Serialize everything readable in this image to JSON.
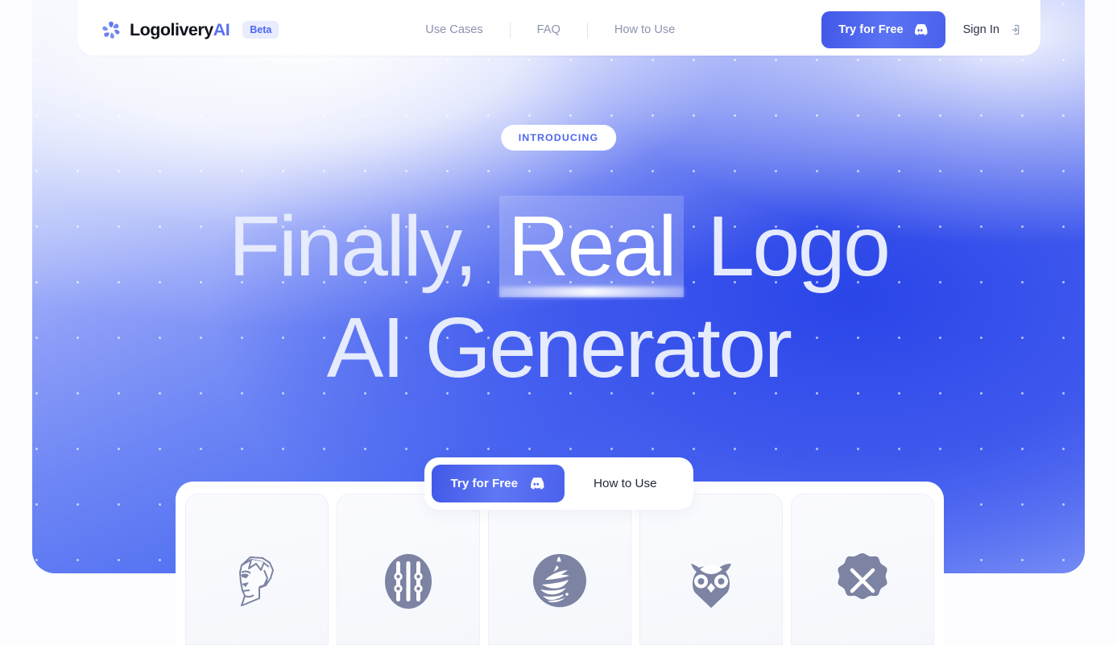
{
  "brand": {
    "name_main": "Logolivery",
    "name_accent": "AI",
    "badge": "Beta",
    "mark_icon": "swirl-petals-logo-icon",
    "accent_color": "#5a72f0"
  },
  "nav": {
    "links": [
      {
        "label": "Use Cases"
      },
      {
        "label": "FAQ"
      },
      {
        "label": "How to Use"
      }
    ],
    "cta": {
      "label": "Try for Free",
      "icon": "discord-icon"
    },
    "sign_in": {
      "label": "Sign In",
      "icon": "login-icon"
    }
  },
  "hero": {
    "badge": "INTRODUCING",
    "headline_line1_a": "Finally,",
    "headline_highlight": "Real",
    "headline_line1_b": "Logo",
    "headline_line2": "AI Generator",
    "highlight_color": "#ffffff",
    "text_color": "#e6ebfd"
  },
  "cta": {
    "primary": {
      "label": "Try for Free",
      "icon": "discord-icon"
    },
    "secondary": {
      "label": "How to Use"
    }
  },
  "cards": [
    {
      "icon": "man-face-profile-icon"
    },
    {
      "icon": "oval-vertical-bars-icon"
    },
    {
      "icon": "ship-waves-circle-icon"
    },
    {
      "icon": "owl-icon"
    },
    {
      "icon": "x-scalloped-badge-icon"
    }
  ]
}
